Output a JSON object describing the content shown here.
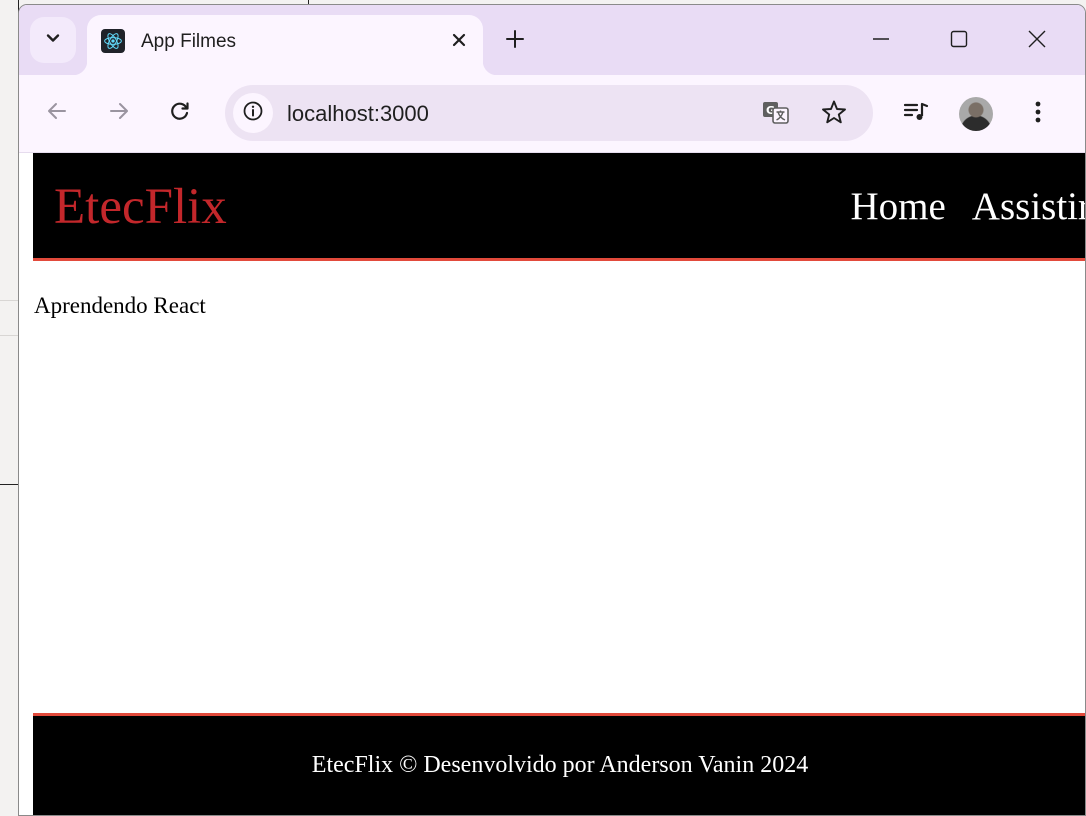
{
  "browser": {
    "tab": {
      "title": "App Filmes",
      "favicon": "react-logo-icon"
    },
    "address_bar": {
      "url": "localhost:3000"
    },
    "icons": {
      "tab_search": "chevron-down-icon",
      "tab_close": "close-icon",
      "new_tab": "plus-icon",
      "minimize": "minimize-icon",
      "maximize": "maximize-icon",
      "close_window": "close-icon",
      "back": "arrow-left-icon",
      "forward": "arrow-right-icon",
      "reload": "reload-icon",
      "site_info": "info-icon",
      "translate": "translate-icon",
      "bookmark": "star-icon",
      "media": "media-control-icon",
      "menu": "more-vertical-icon"
    }
  },
  "site": {
    "header": {
      "logo": "EtecFlix",
      "nav": [
        {
          "label": "Home"
        },
        {
          "label": "Assistir"
        }
      ]
    },
    "main": {
      "text": "Aprendendo React"
    },
    "footer": {
      "text": "EtecFlix © Desenvolvido por Anderson Vanin 2024"
    }
  },
  "colors": {
    "header_bg": "#000000",
    "logo": "#c3272b",
    "accent_border": "#e24a3b",
    "tabstrip_bg": "#e9dcf5",
    "toolbar_bg": "#fcf5ff"
  }
}
